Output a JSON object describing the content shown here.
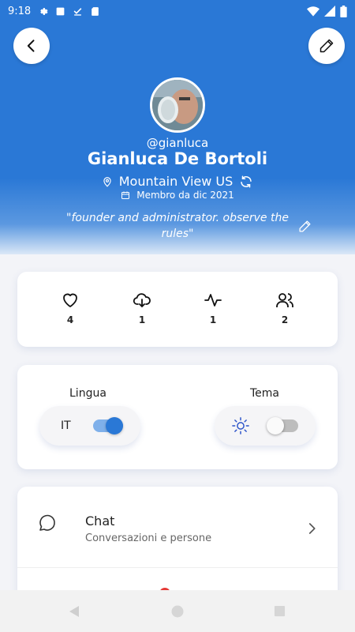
{
  "status_bar": {
    "time": "9:18"
  },
  "profile": {
    "username": "@gianluca",
    "name": "Gianluca De Bortoli",
    "location": "Mountain View US",
    "member_since": "Membro da dic 2021",
    "bio": "\"founder and administrator. observe the rules\""
  },
  "stats": [
    {
      "icon": "heart-icon",
      "value": "4"
    },
    {
      "icon": "cloud-download-icon",
      "value": "1"
    },
    {
      "icon": "activity-icon",
      "value": "1"
    },
    {
      "icon": "users-icon",
      "value": "2"
    }
  ],
  "preferences": {
    "language_label": "Lingua",
    "language_value": "IT",
    "language_toggle_on": true,
    "theme_label": "Tema",
    "theme_dark_on": false
  },
  "menu": [
    {
      "icon": "chat-bubble-icon",
      "title": "Chat",
      "subtitle": "Conversazioni e persone"
    }
  ],
  "colors": {
    "brand_blue": "#2a78d6",
    "toggle_on_knob": "#2a78d6",
    "toggle_on_track": "#7fb0ea",
    "notification_red": "#e53935"
  }
}
